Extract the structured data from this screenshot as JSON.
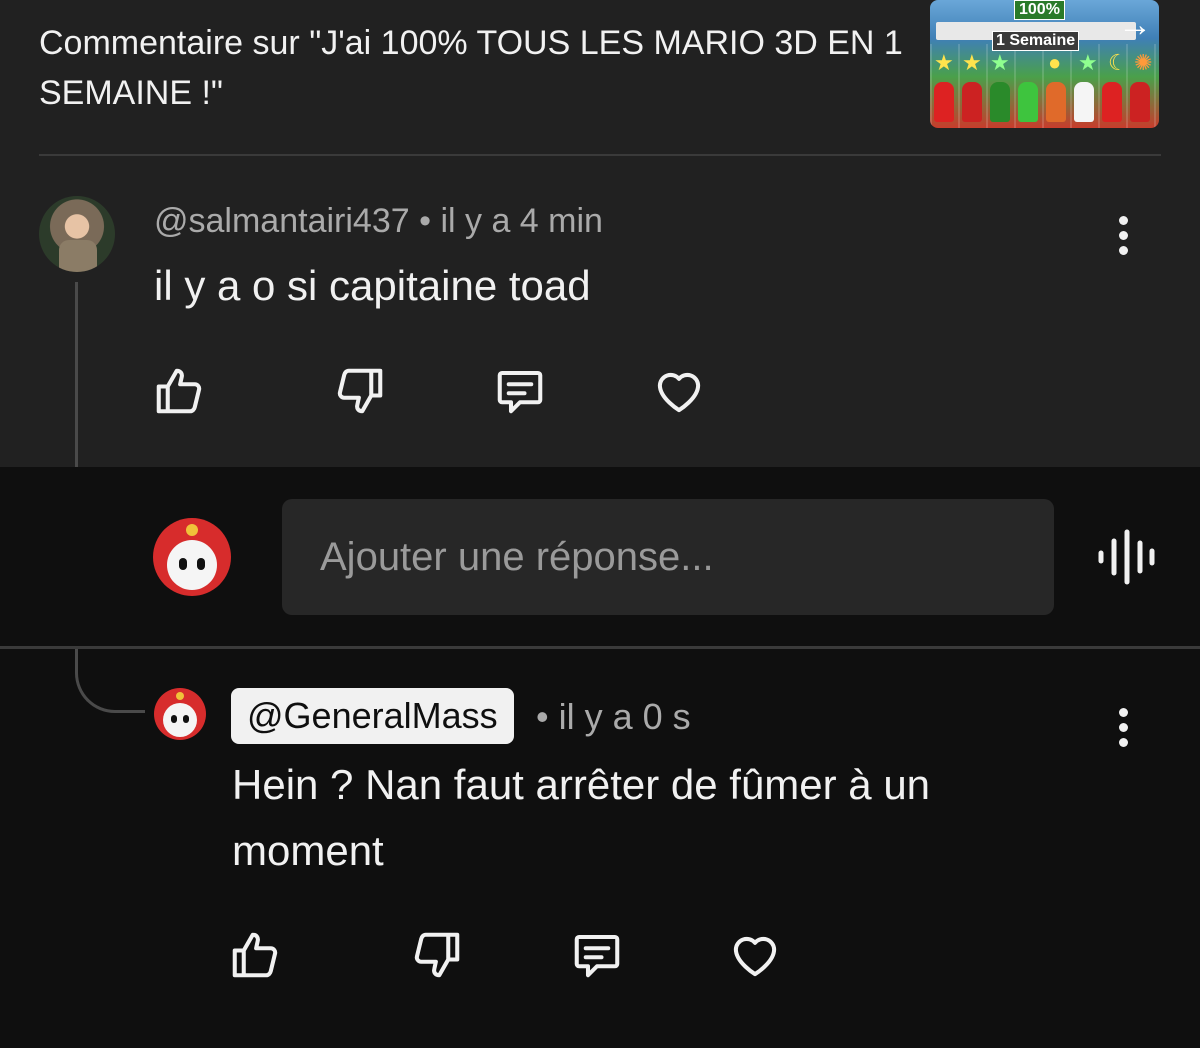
{
  "video": {
    "title": "Commentaire sur \"J'ai 100% TOUS LES MARIO 3D EN 1 SEMAINE !\"",
    "thumbnail_text_top": "100%",
    "thumbnail_text_banner": "1 Semaine"
  },
  "comment": {
    "author": "@salmantairi437",
    "time": "il y a 4 min",
    "separator": "•",
    "text": "il y a o si capitaine toad"
  },
  "reply_input": {
    "placeholder": "Ajouter une réponse..."
  },
  "reply": {
    "author": "@GeneralMass",
    "time": "il y a 0 s",
    "separator": "•",
    "text": "Hein ? Nan faut arrêter de fûmer à un moment"
  },
  "icons": {
    "like": "thumbs-up-icon",
    "dislike": "thumbs-down-icon",
    "reply": "comment-icon",
    "heart": "heart-icon",
    "more": "more-vertical-icon",
    "voice": "voice-wave-icon"
  },
  "colors": {
    "top_background": "#212121",
    "page_background": "#0f0f0f",
    "input_background": "#272727",
    "meta_text": "#aaaaaa"
  }
}
